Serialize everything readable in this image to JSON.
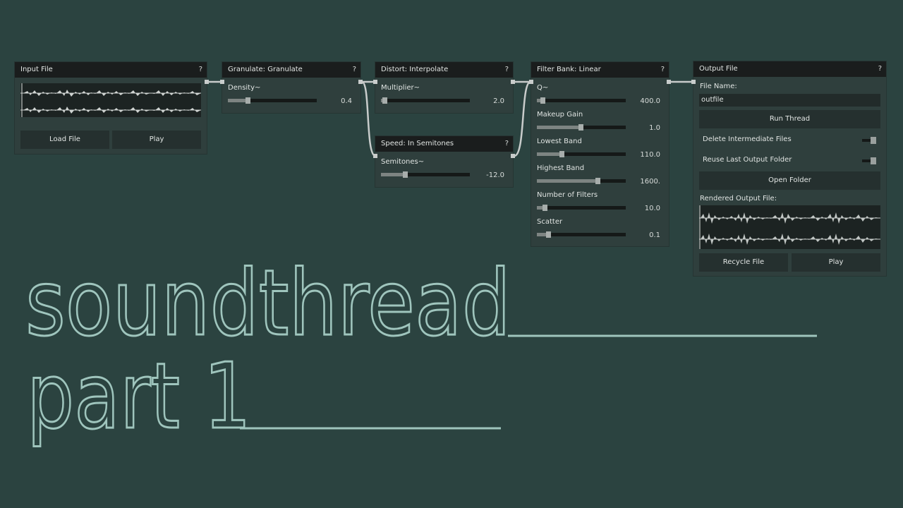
{
  "nodes": {
    "input_file": {
      "title": "Input File",
      "help": "?",
      "load_label": "Load File",
      "play_label": "Play"
    },
    "granulate": {
      "title": "Granulate: Granulate",
      "help": "?",
      "params": [
        {
          "label": "Density~",
          "value": "0.4",
          "level": 0.22
        }
      ]
    },
    "distort": {
      "title": "Distort: Interpolate",
      "help": "?",
      "params": [
        {
          "label": "Multiplier~",
          "value": "2.0",
          "level": 0.04
        }
      ]
    },
    "speed": {
      "title": "Speed: In Semitones",
      "help": "?",
      "params": [
        {
          "label": "Semitones~",
          "value": "-12.0",
          "level": 0.27
        }
      ]
    },
    "filter_bank": {
      "title": "Filter Bank: Linear",
      "help": "?",
      "params": [
        {
          "label": "Q~",
          "value": "400.0",
          "level": 0.06
        },
        {
          "label": "Makeup Gain",
          "value": "1.0",
          "level": 0.49
        },
        {
          "label": "Lowest Band",
          "value": "110.0",
          "level": 0.28
        },
        {
          "label": "Highest Band",
          "value": "1600.",
          "level": 0.68
        },
        {
          "label": "Number of Filters",
          "value": "10.0",
          "level": 0.09
        },
        {
          "label": "Scatter",
          "value": "0.1",
          "level": 0.13
        }
      ]
    },
    "output_file": {
      "title": "Output File",
      "help": "?",
      "file_name_label": "File Name:",
      "file_name_value": "outfile",
      "run_label": "Run Thread",
      "delete_label": "Delete Intermediate Files",
      "delete_on": true,
      "reuse_label": "Reuse Last Output Folder",
      "reuse_on": true,
      "open_folder_label": "Open Folder",
      "rendered_label": "Rendered Output File:",
      "recycle_label": "Recycle File",
      "play_label": "Play"
    }
  },
  "title_overlay": {
    "line1": "soundthread",
    "line2": "part 1"
  },
  "colors": {
    "background": "#2b4340",
    "node_bg": "#2f3f3d",
    "header_bg": "#1a1d1d",
    "title_stroke": "#9fc5bd",
    "wire": "#c8cccb"
  }
}
